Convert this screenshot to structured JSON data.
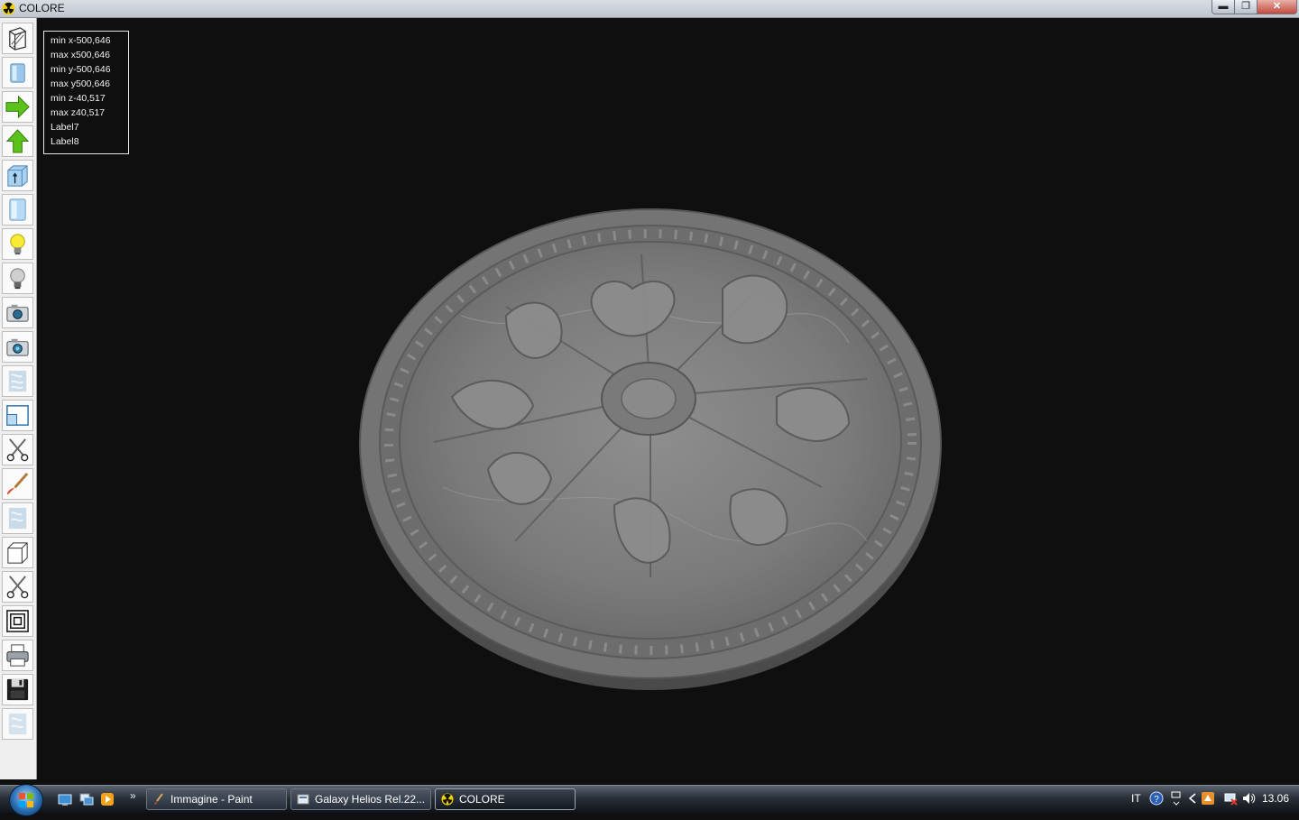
{
  "window": {
    "title": "COLORE",
    "min_label": "▬",
    "max_label": "❐",
    "close_label": "✕"
  },
  "toolbar": {
    "tools": [
      "wireframe-view-icon",
      "solid-view-icon",
      "arrow-right-icon",
      "arrow-up-icon",
      "box-elevation-icon",
      "panel-view-icon",
      "light-on-icon",
      "light-off-icon",
      "camera-icon",
      "camera-alt-icon",
      "texture-icon",
      "window-icon",
      "scissors-icon",
      "paint-brush-icon",
      "texture-alt-icon",
      "cube-icon",
      "scissors-alt-icon",
      "concentric-squares-icon",
      "printer-icon",
      "save-disk-icon",
      "texture-faded-icon"
    ]
  },
  "info": {
    "lines": [
      "min x-500,646",
      "max x500,646",
      "min y-500,646",
      "max y500,646",
      "min z-40,517",
      "max z40,517",
      "Label7",
      "Label8"
    ]
  },
  "taskbar": {
    "chevrons": "»",
    "tasks": [
      {
        "label": "Immagine - Paint",
        "icon": "paint-app-icon"
      },
      {
        "label": "Galaxy Helios  Rel.22...",
        "icon": "galaxy-app-icon"
      },
      {
        "label": "COLORE",
        "icon": "colore-app-icon",
        "active": true
      }
    ],
    "tray": {
      "language": "IT",
      "clock": "13.06"
    }
  }
}
